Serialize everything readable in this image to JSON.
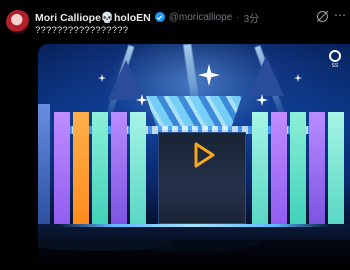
{
  "tweet": {
    "display_name": "Mori Calliope💀holoEN",
    "handle": "@moricalliope",
    "separator": "·",
    "time": "3分",
    "text": "?????????????????"
  },
  "media": {
    "play_icon_color": "#f5a623",
    "logo_text": "SS"
  },
  "colors": {
    "background": "#000000",
    "verified_badge": "#1d9bf0",
    "secondary_text": "#71767b"
  },
  "icons": [
    "avatar",
    "verified-badge-icon",
    "grok-icon",
    "more-icon",
    "play-icon"
  ]
}
